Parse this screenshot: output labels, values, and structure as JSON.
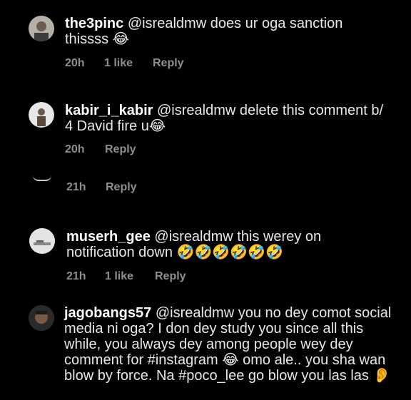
{
  "comments": [
    {
      "username": "the3pinc",
      "body": "@isrealdmw does ur oga sanction thissss 😂",
      "time": "20h",
      "likes": "1 like",
      "reply": "Reply"
    },
    {
      "username": "kabir_i_kabir",
      "body": "@isrealdmw delete this comment b/ 4 David fire u😂",
      "time": "20h",
      "reply": "Reply"
    },
    {
      "time": "21h",
      "reply": "Reply"
    },
    {
      "username": "muserh_gee",
      "body": "@isrealdmw this werey on notification down 🤣🤣🤣🤣🤣🤣",
      "time": "21h",
      "likes": "1 like",
      "reply": "Reply"
    },
    {
      "username": "jagobangs57",
      "body": "@isrealdmw you no dey comot social media ni oga? I don dey study you since all this while, you always dey among people wey dey comment for #instagram 😂 omo ale.. you sha wan blow by force. Na #poco_lee go blow you las las 👂"
    }
  ]
}
